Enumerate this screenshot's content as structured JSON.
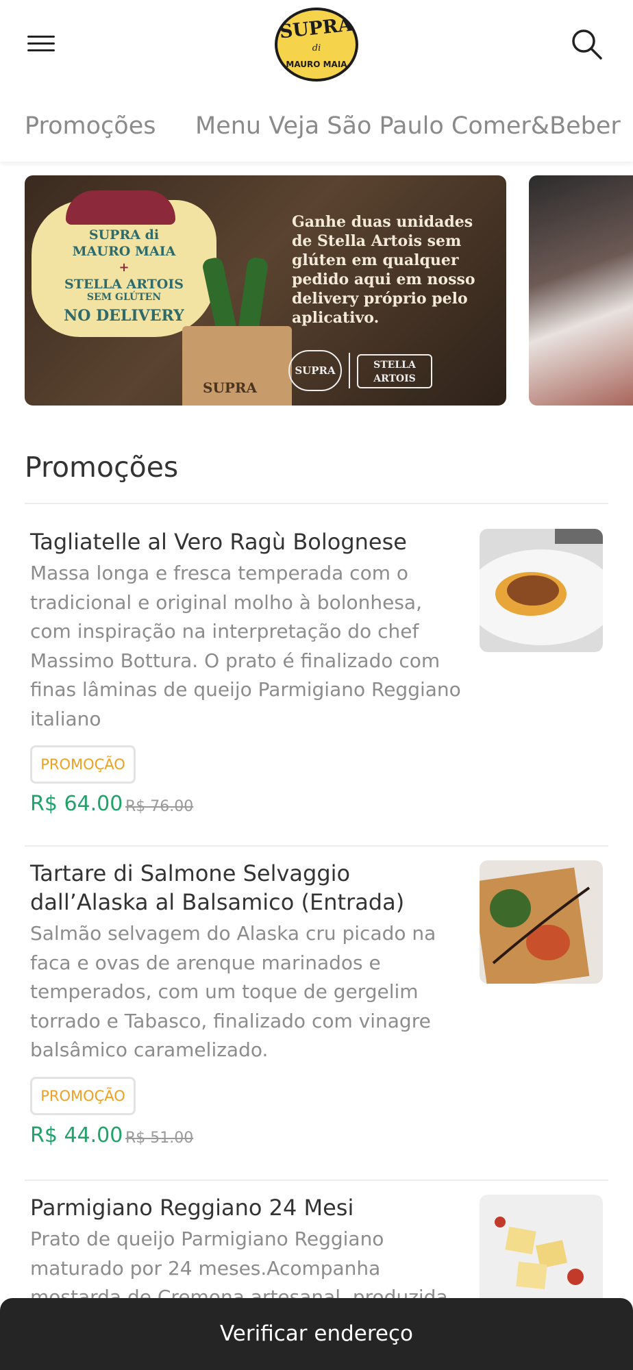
{
  "header": {
    "logo_brand": "SUPRA",
    "logo_di": "di",
    "logo_owner": "MAURO MAIA"
  },
  "tabs": [
    {
      "label": "Promoções"
    },
    {
      "label": "Menu Veja São Paulo Comer&Beber"
    }
  ],
  "banner": {
    "badge_line1": "SUPRA di",
    "badge_line2": "MAURO MAIA",
    "badge_line3": "+",
    "badge_line4": "STELLA ARTOIS",
    "badge_line5": "SEM GLÚTEN",
    "badge_line6": "NO DELIVERY",
    "headline": "Ganhe duas unidades de Stella Artois sem glúten em qualquer pedido aqui em nosso delivery próprio pelo aplicativo.",
    "bag_text": "SUPRA",
    "logo_supra": "SUPRA",
    "logo_stella": "STELLA ARTOIS"
  },
  "section": {
    "title": "Promoções"
  },
  "items": [
    {
      "name": "Tagliatelle al Vero Ragù Bolognese",
      "description": "Massa longa e fresca temperada com o tradicional e original molho à bolonhesa, com inspiração na interpretação do chef Massimo Bottura. O prato é finalizado com finas lâminas de queijo Parmigiano Reggiano italiano",
      "badge": "PROMOÇÃO",
      "price": "R$ 64.00",
      "old_price": "R$ 76.00"
    },
    {
      "name": "Tartare di Salmone Selvaggio dall’Alaska al Balsamico (Entrada)",
      "description": "Salmão selvagem do Alaska cru picado na faca e ovas de arenque marinados e temperados, com um toque de gergelim torrado e Tabasco, finalizado com vinagre balsâmico caramelizado.",
      "badge": "PROMOÇÃO",
      "price": "R$ 44.00",
      "old_price": "R$ 51.00"
    },
    {
      "name": "Parmigiano Reggiano 24 Mesi",
      "description": "Prato de queijo Parmigiano Reggiano maturado por 24 meses.Acompanha mostarda de Cremona artesanal, produzida"
    }
  ],
  "bottom_bar": {
    "label": "Verificar endereço"
  },
  "colors": {
    "price_green": "#20a26a",
    "promo_orange": "#f0a020",
    "logo_yellow": "#f5d34a",
    "bottom_bar": "#252525"
  }
}
